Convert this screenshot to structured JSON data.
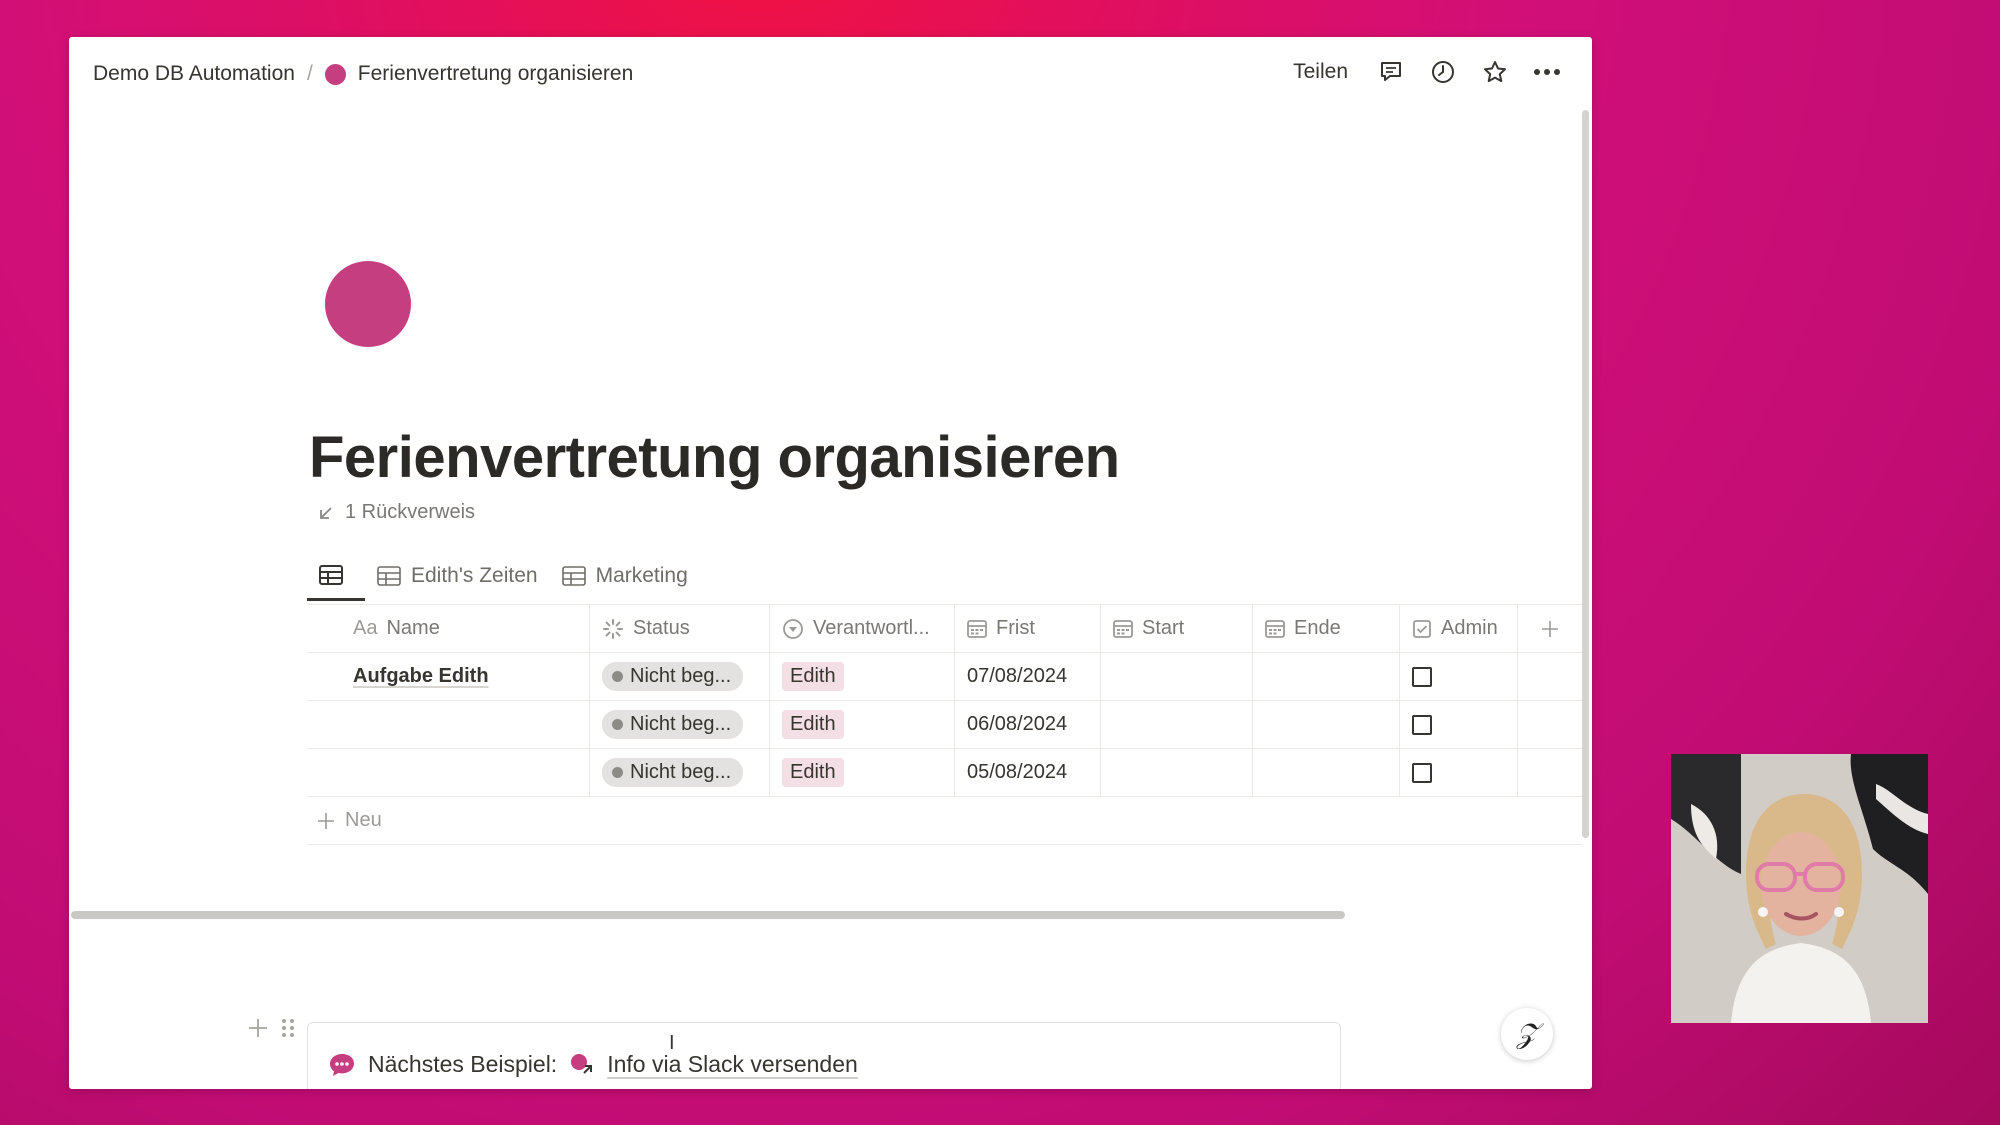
{
  "breadcrumb": {
    "workspace": "Demo DB Automation",
    "separator": "/",
    "page": "Ferienvertretung organisieren"
  },
  "topbar": {
    "share_label": "Teilen"
  },
  "page": {
    "title": "Ferienvertretung organisieren",
    "backlinks": "1 Rückverweis"
  },
  "views": {
    "tabs": [
      {
        "label": ""
      },
      {
        "label": "Edith's Zeiten"
      },
      {
        "label": "Marketing"
      }
    ]
  },
  "table": {
    "headers": {
      "name_prefix": "Aa",
      "name": "Name",
      "status": "Status",
      "responsible": "Verantwortl...",
      "deadline": "Frist",
      "start": "Start",
      "end": "Ende",
      "admin": "Admin"
    },
    "rows": [
      {
        "name": "Aufgabe Edith",
        "status": "Nicht beg...",
        "responsible": "Edith",
        "deadline": "07/08/2024",
        "start": "",
        "end": "",
        "admin": false
      },
      {
        "name": "",
        "status": "Nicht beg...",
        "responsible": "Edith",
        "deadline": "06/08/2024",
        "start": "",
        "end": "",
        "admin": false
      },
      {
        "name": "",
        "status": "Nicht beg...",
        "responsible": "Edith",
        "deadline": "05/08/2024",
        "start": "",
        "end": "",
        "admin": false
      }
    ],
    "new_label": "Neu"
  },
  "callout": {
    "prefix": "Nächstes Beispiel:",
    "link": "Info via Slack versenden"
  },
  "colors": {
    "accent": "#c43e80",
    "background": "#d10f79",
    "person_tag": "#f5dfe6",
    "status_tag": "#e3e2e0"
  }
}
